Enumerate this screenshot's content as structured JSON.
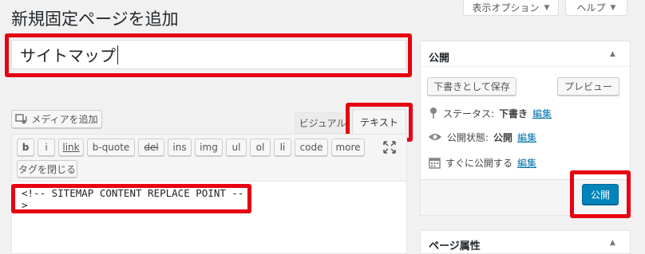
{
  "top": {
    "screen_options_label": "表示オプション",
    "help_label": "ヘルプ"
  },
  "page_title": "新規固定ページを追加",
  "title_field": {
    "value": "サイトマップ"
  },
  "editor": {
    "add_media_label": "メディアを追加",
    "tab_visual": "ビジュアル",
    "tab_text": "テキスト",
    "quicktags": [
      "b",
      "i",
      "link",
      "b-quote",
      "del",
      "ins",
      "img",
      "ul",
      "ol",
      "li",
      "code",
      "more"
    ],
    "close_tags_label": "タグを閉じる",
    "content": "<!-- SITEMAP CONTENT REPLACE POINT -->"
  },
  "publish_box": {
    "title": "公開",
    "save_draft_label": "下書きとして保存",
    "preview_label": "プレビュー",
    "status_label": "ステータス:",
    "status_value": "下書き",
    "visibility_label": "公開状態:",
    "visibility_value": "公開",
    "schedule_label": "すぐに公開する",
    "edit_link": "編集",
    "publish_label": "公開"
  },
  "attributes_box": {
    "title": "ページ属性"
  },
  "colors": {
    "accent": "#0085ba",
    "highlight": "#e60012",
    "link": "#0073aa"
  }
}
